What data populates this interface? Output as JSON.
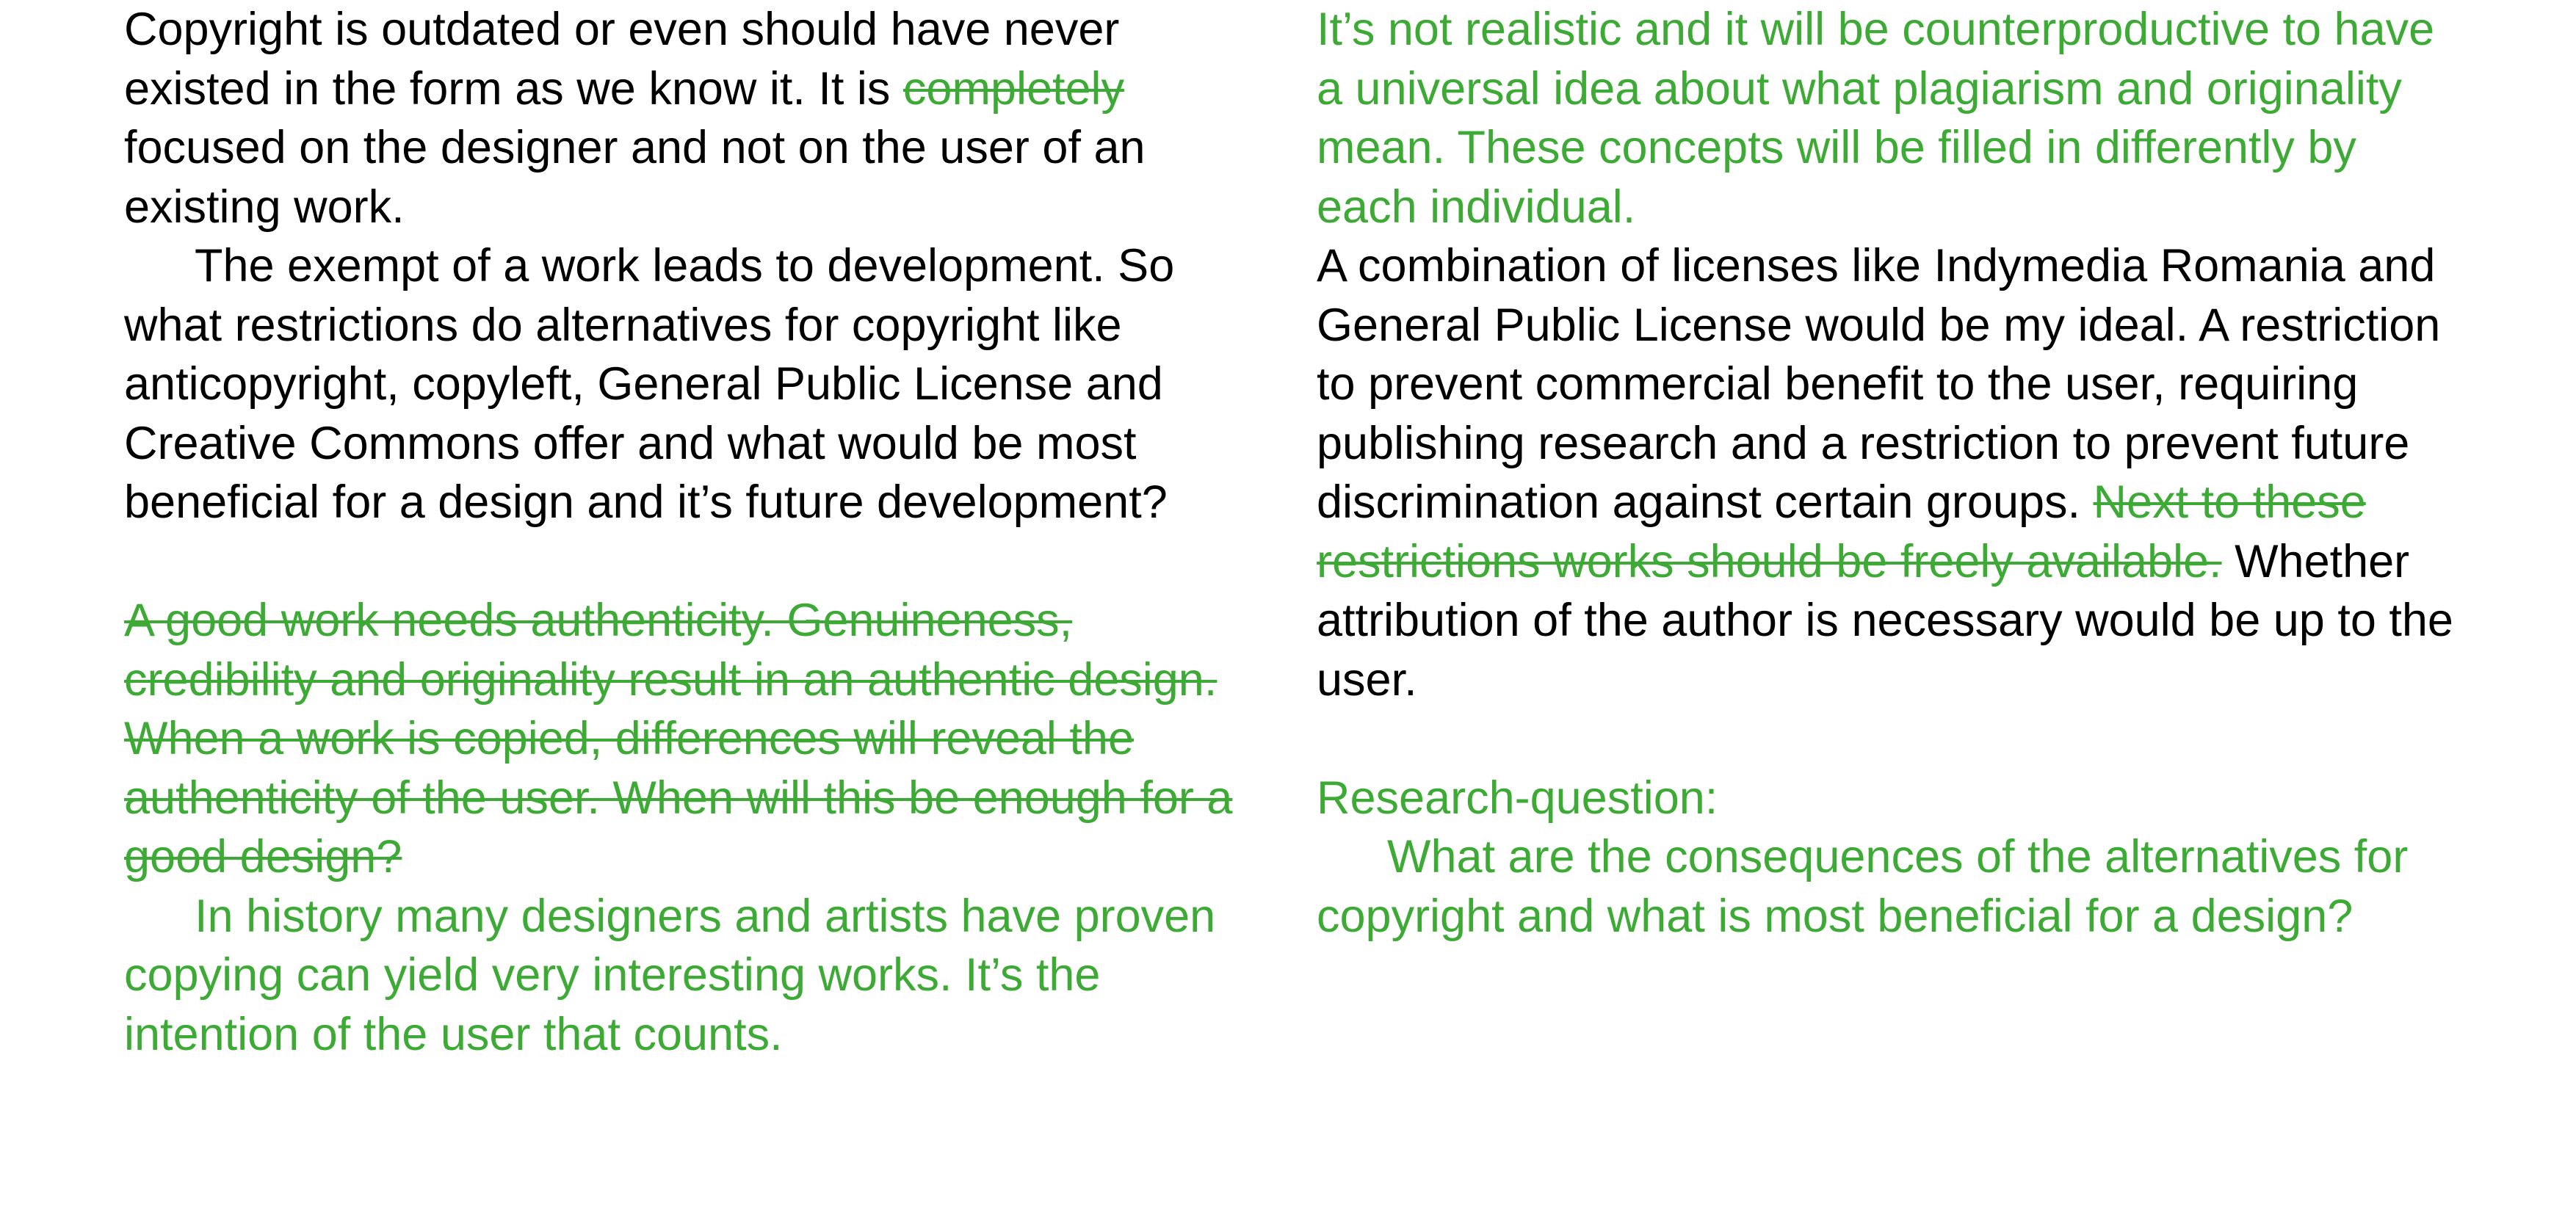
{
  "left_column": {
    "p1_before": "Copyright is outdated or even should have never existed in the form as we know it. It is ",
    "p1_struck": "completely",
    "p1_after": " focused on the designer and not on the user of an existing work.",
    "p2": "The exempt of a work leads to development. So what restrictions do alternatives for copyright like anticopyright, copyleft, General Public License and Creative Commons offer and what would be most beneficial for a design and it’s future development?",
    "p3_struck": "A good work needs authenticity. Genuineness, credibility and originality result in an authentic design. When a work is copied, differences will reveal the authenticity of the user. When will this be enough for a good design?",
    "p4": "In history many designers and artists have proven copying can yield very interesting works. It’s the intention of the user that counts."
  },
  "right_column": {
    "p1": "It’s not realistic and it will be counterproductive to have a universal idea about what plagiarism and originality mean. These concepts will be filled in differently by each individual.",
    "p2_main": "A combination of licenses like Indymedia Romania and General Public License would be my ideal. A restriction to prevent commercial benefit to the user, requiring publishing research and a restriction to prevent future discrimination against certain groups. ",
    "p2_struck": "Next to these restrictions works should be freely available.",
    "p2_after": " Whether attribution of the author is necessary would be up to the user.",
    "research_label": "Research-question:",
    "research_question": "What are the consequences of the alternatives for copyright and what is most beneficial for a design?"
  },
  "colors": {
    "body_text": "#000000",
    "annotation_green": "#3daa35"
  }
}
